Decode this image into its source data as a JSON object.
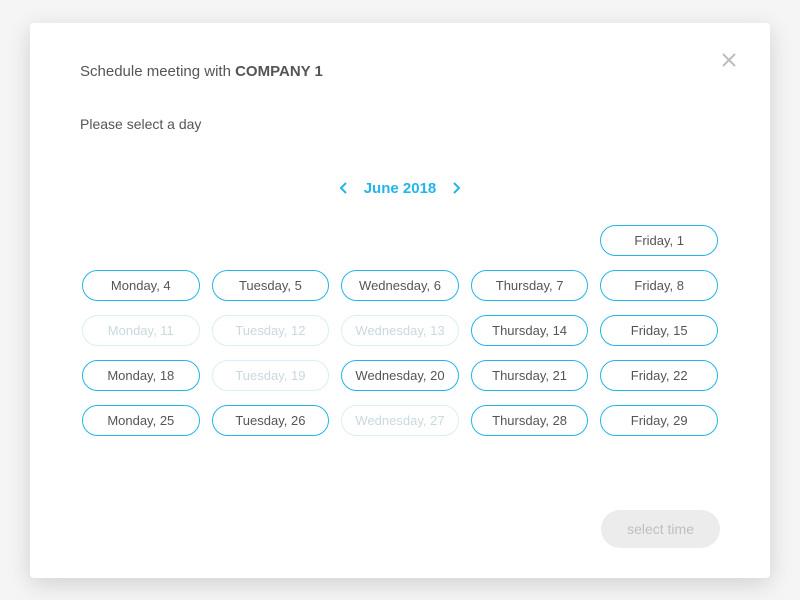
{
  "header": {
    "title_prefix": "Schedule meeting with ",
    "company": "COMPANY 1"
  },
  "subtitle": "Please select a day",
  "month": {
    "label": "June 2018"
  },
  "days": [
    {
      "label": "",
      "state": "empty"
    },
    {
      "label": "",
      "state": "empty"
    },
    {
      "label": "",
      "state": "empty"
    },
    {
      "label": "",
      "state": "empty"
    },
    {
      "label": "Friday, 1",
      "state": "available"
    },
    {
      "label": "Monday, 4",
      "state": "available"
    },
    {
      "label": "Tuesday,  5",
      "state": "available"
    },
    {
      "label": "Wednesday, 6",
      "state": "available"
    },
    {
      "label": "Thursday, 7",
      "state": "available"
    },
    {
      "label": "Friday, 8",
      "state": "available"
    },
    {
      "label": "Monday, 11",
      "state": "disabled"
    },
    {
      "label": "Tuesday, 12",
      "state": "disabled"
    },
    {
      "label": "Wednesday, 13",
      "state": "disabled"
    },
    {
      "label": "Thursday, 14",
      "state": "available"
    },
    {
      "label": "Friday, 15",
      "state": "available"
    },
    {
      "label": "Monday, 18",
      "state": "available"
    },
    {
      "label": "Tuesday, 19",
      "state": "disabled"
    },
    {
      "label": "Wednesday, 20",
      "state": "available"
    },
    {
      "label": "Thursday, 21",
      "state": "available"
    },
    {
      "label": "Friday, 22",
      "state": "available"
    },
    {
      "label": "Monday, 25",
      "state": "available"
    },
    {
      "label": "Tuesday, 26",
      "state": "available"
    },
    {
      "label": "Wednesday, 27",
      "state": "disabled"
    },
    {
      "label": "Thursday, 28",
      "state": "available"
    },
    {
      "label": "Friday, 29",
      "state": "available"
    }
  ],
  "actions": {
    "select_time_label": "select time"
  }
}
